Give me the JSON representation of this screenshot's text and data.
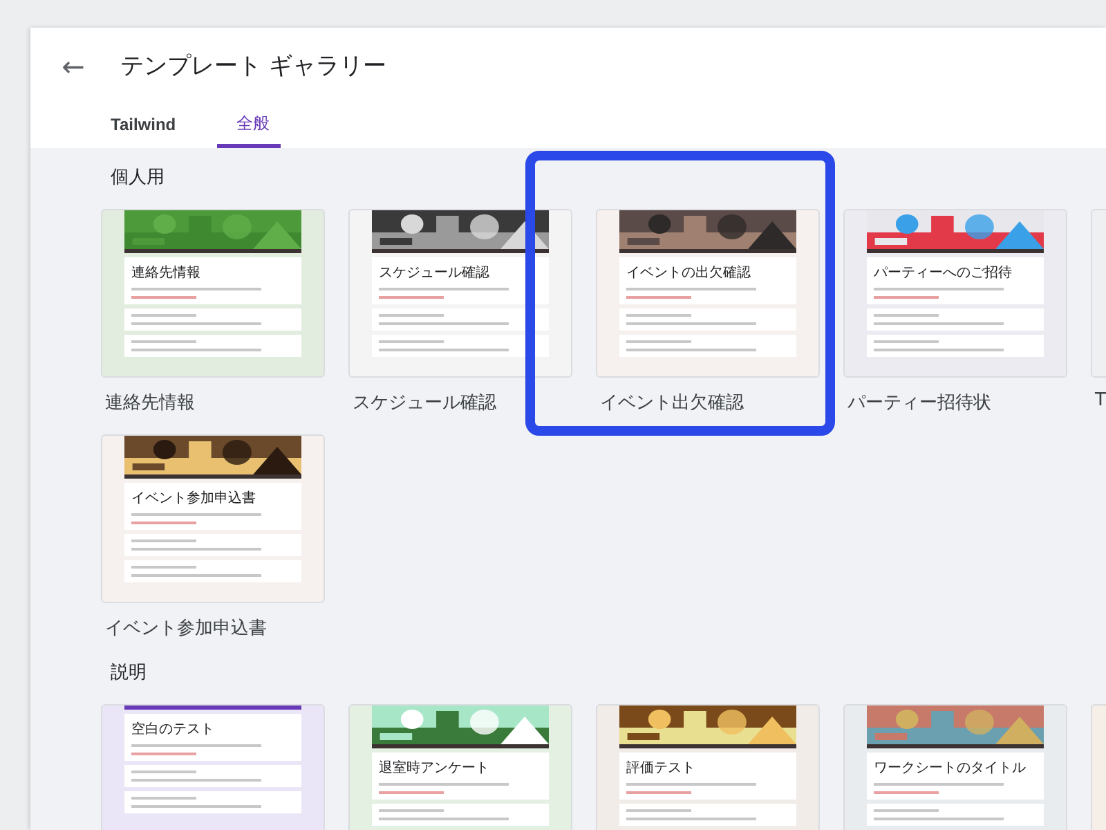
{
  "window": {
    "title": "テンプレート ギャラリー",
    "back_icon": "←"
  },
  "tabs": [
    {
      "label": "Tailwind",
      "selected": false
    },
    {
      "label": "全般",
      "selected": true
    }
  ],
  "sections": [
    {
      "title": "個人用",
      "templates": [
        {
          "title": "連絡先情報",
          "form_title": "連絡先情報",
          "kind": "banner",
          "color": "#e3eddf"
        },
        {
          "title": "スケジュール確認",
          "form_title": "スケジュール確認",
          "kind": "banner",
          "color": "#f4f4f4"
        },
        {
          "title": "イベント出欠確認",
          "form_title": "イベントの出欠確認",
          "kind": "banner",
          "color": "#f6f1ee",
          "highlighted": true
        },
        {
          "title": "パーティー招待状",
          "form_title": "パーティーへのご招待",
          "kind": "banner",
          "color": "#ebebf1"
        },
        {
          "title": "T",
          "kind": "edge",
          "color": "#eef0f2"
        }
      ]
    },
    {
      "templates": [
        {
          "title": "イベント参加申込書",
          "form_title": "イベント参加申込書",
          "kind": "banner",
          "color": "#f6f1ee"
        }
      ]
    },
    {
      "title": "説明",
      "templates": [
        {
          "form_title": "空白のテスト",
          "kind": "plain",
          "color": "#ebe6f7"
        },
        {
          "form_title": "退室時アンケート",
          "kind": "banner",
          "color": "#e4f0e2"
        },
        {
          "form_title": "評価テスト",
          "kind": "banner",
          "color": "#f2ece8"
        },
        {
          "form_title": "ワークシートのタイトル",
          "kind": "banner",
          "color": "#e8ecef"
        },
        {
          "kind": "edge",
          "color": "#f6efe8"
        }
      ]
    }
  ]
}
